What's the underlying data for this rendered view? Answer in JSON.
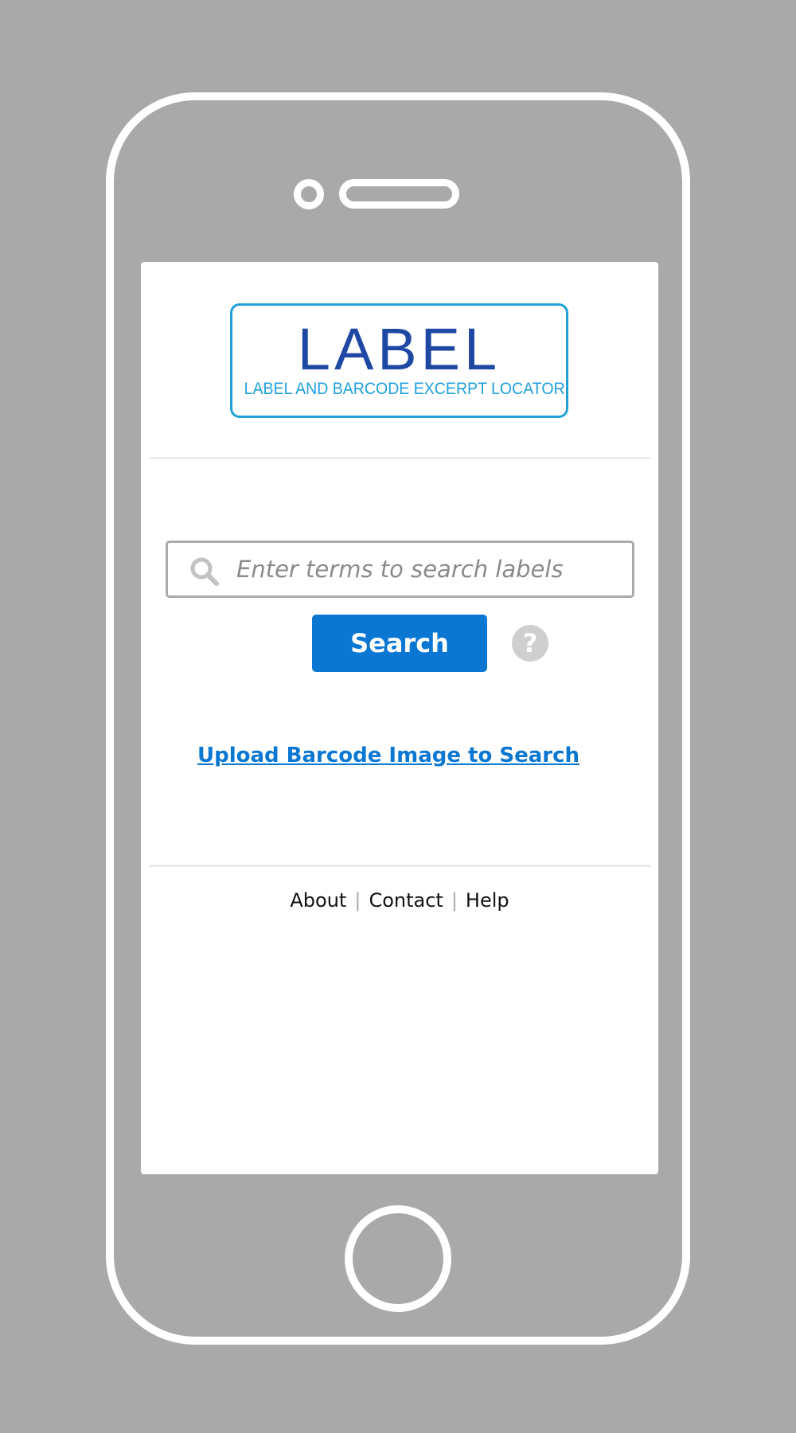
{
  "logo": {
    "wordmark": "LABEL",
    "tagline": "LABEL AND BARCODE EXCERPT LOCATOR"
  },
  "search": {
    "placeholder": "Enter terms to search labels",
    "value": "",
    "button_label": "Search",
    "help_glyph": "?"
  },
  "upload": {
    "link_label": "Upload Barcode Image to Search"
  },
  "footer": {
    "links": [
      "About",
      "Contact",
      "Help"
    ],
    "separator": "|"
  },
  "colors": {
    "background": "#a9a9a9",
    "logo_primary": "#1e48a3",
    "logo_accent": "#1fa0db",
    "button": "#0a77d2",
    "link": "#0a77d2"
  },
  "icons": {
    "search": "search-icon",
    "help": "help-icon"
  }
}
